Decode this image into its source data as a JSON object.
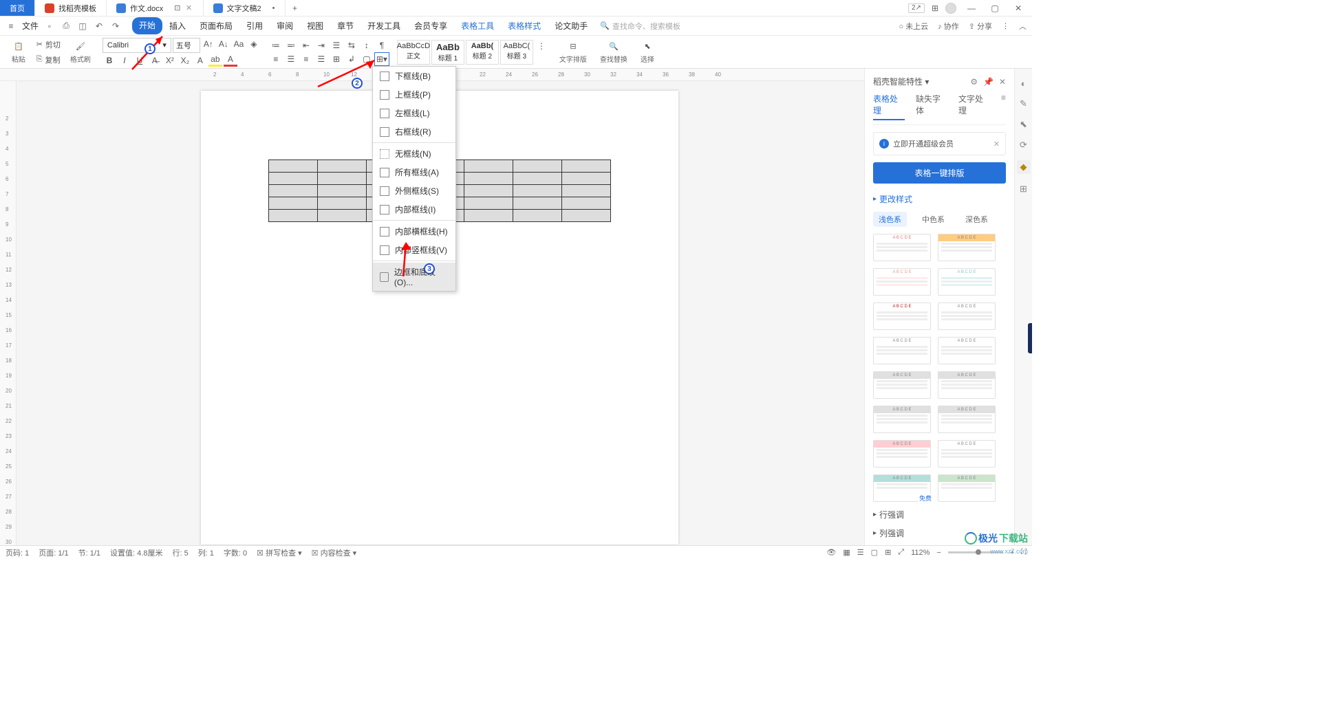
{
  "titlebar": {
    "tabs": [
      {
        "label": "首页"
      },
      {
        "label": "找稻壳模板"
      },
      {
        "label": "作文.docx"
      },
      {
        "label": "文字文稿2"
      }
    ],
    "badge_num": "2",
    "win": {
      "min": "—",
      "max": "▢",
      "close": "✕"
    }
  },
  "menubar": {
    "file": "文件",
    "items": [
      "开始",
      "插入",
      "页面布局",
      "引用",
      "审阅",
      "视图",
      "章节",
      "开发工具",
      "会员专享",
      "表格工具",
      "表格样式",
      "论文助手"
    ],
    "search_hint": "查找命令、搜索模板",
    "right": {
      "cloud": "未上云",
      "collab": "协作",
      "share": "分享"
    }
  },
  "ribbon": {
    "clipboard": {
      "paste": "粘贴",
      "cut": "剪切",
      "copy": "复制",
      "format_painter": "格式刷"
    },
    "font": {
      "name": "Calibri",
      "size": "五号"
    },
    "styles": [
      {
        "preview": "AaBbCcD",
        "name": "正文"
      },
      {
        "preview": "AaBb",
        "name": "标题 1"
      },
      {
        "preview": "AaBb(",
        "name": "标题 2"
      },
      {
        "preview": "AaBbC(",
        "name": "标题 3"
      }
    ],
    "layout": "文字排版",
    "find": "查找替换",
    "select": "选择"
  },
  "border_menu": [
    "下框线(B)",
    "上框线(P)",
    "左框线(L)",
    "右框线(R)",
    "无框线(N)",
    "所有框线(A)",
    "外侧框线(S)",
    "内部框线(I)",
    "内部横框线(H)",
    "内部竖框线(V)",
    "边框和底纹(O)..."
  ],
  "side": {
    "title": "稻壳智能特性",
    "tabs": [
      "表格处理",
      "缺失字体",
      "文字处理"
    ],
    "promo": "立即开通超级会员",
    "action": "表格一键排版",
    "section1": "更改样式",
    "schemes": [
      "浅色系",
      "中色系",
      "深色系"
    ],
    "free": "免费",
    "row_emph": "行强调",
    "col_emph": "列强调"
  },
  "status": {
    "page": "页码: 1",
    "pages": "页面: 1/1",
    "section": "节: 1/1",
    "pos": "设置值: 4.8厘米",
    "row": "行: 5",
    "col": "列: 1",
    "words": "字数: 0",
    "spell": "拼写检查",
    "content": "内容检查",
    "zoom": "112%"
  },
  "watermark": {
    "t1": "极光",
    "t2": "下载站",
    "url": "www.xz7.com"
  },
  "badges": {
    "b1": "1",
    "b2": "2",
    "b3": "3"
  }
}
